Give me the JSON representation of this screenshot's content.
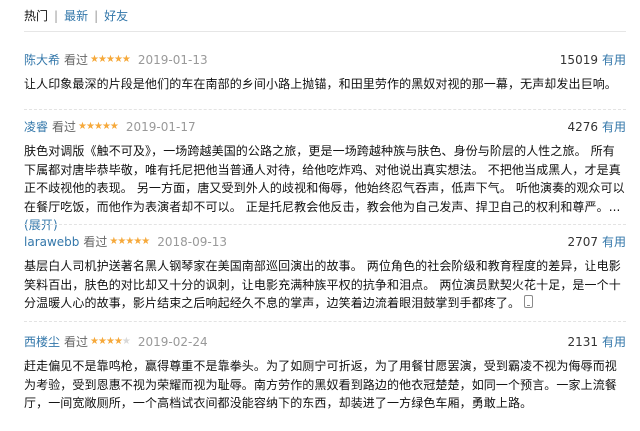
{
  "tabs": {
    "current": "热门",
    "latest": "最新",
    "friends": "好友",
    "separator": "|"
  },
  "stars_glyph": "★",
  "watched_label": "看过",
  "vote_label": "有用",
  "reviews": [
    {
      "author": "陈大希",
      "rating": 5,
      "date": "2019-01-13",
      "votes": "15019",
      "body": "让人印象最深的片段是他们的车在南部的乡间小路上抛锚，和田里劳作的黑奴对视的那一幕，无声却发出巨响。"
    },
    {
      "author": "凌睿",
      "rating": 5,
      "date": "2019-01-17",
      "votes": "4276",
      "body": "肤色对调版《触不可及》，一场跨越美国的公路之旅，更是一场跨越种族与肤色、身份与阶层的人性之旅。 所有下属都对唐毕恭毕敬，唯有托尼把他当普通人对待，给他吃炸鸡、对他说出真实想法。 不把他当成黑人，才是真正不歧视他的表现。 另一方面，唐又受到外人的歧视和侮辱，他始终忍气吞声，低声下气。 听他演奏的观众可以在餐厅吃饭，而他作为表演者却不可以。 正是托尼教会他反击，教会他为自己发声、捍卫自己的权利和尊严。...",
      "expand": "(展开)"
    },
    {
      "author": "larawebb",
      "rating": 5,
      "date": "2018-09-13",
      "votes": "2707",
      "body": "基层白人司机护送著名黑人钢琴家在美国南部巡回演出的故事。 两位角色的社会阶级和教育程度的差异，让电影笑料百出，肤色的对比却又十分的讽刺，让电影充满种族平权的抗争和泪点。 两位演员默契火花十足，是一个十分温暖人心的故事，影片结束之后响起经久不息的掌声，边笑着边流着眼泪鼓掌到手都疼了。",
      "device": "phone-icon"
    },
    {
      "author": "西楼尘",
      "rating": 4,
      "date": "2019-02-24",
      "votes": "2131",
      "body": "赶走偏见不是靠鸣枪，赢得尊重不是靠拳头。为了如厕宁可折返，为了用餐甘愿罢演，受到霸凌不视为侮辱而视为考验，受到恩惠不视为荣耀而视为耻辱。南方劳作的黑奴看到路边的他衣冠楚楚，如同一个预言。一家上流餐厅，一间宽敞厕所，一个高档试衣间都没能容纳下的东西，却装进了一方绿色车厢，勇敢上路。"
    }
  ]
}
